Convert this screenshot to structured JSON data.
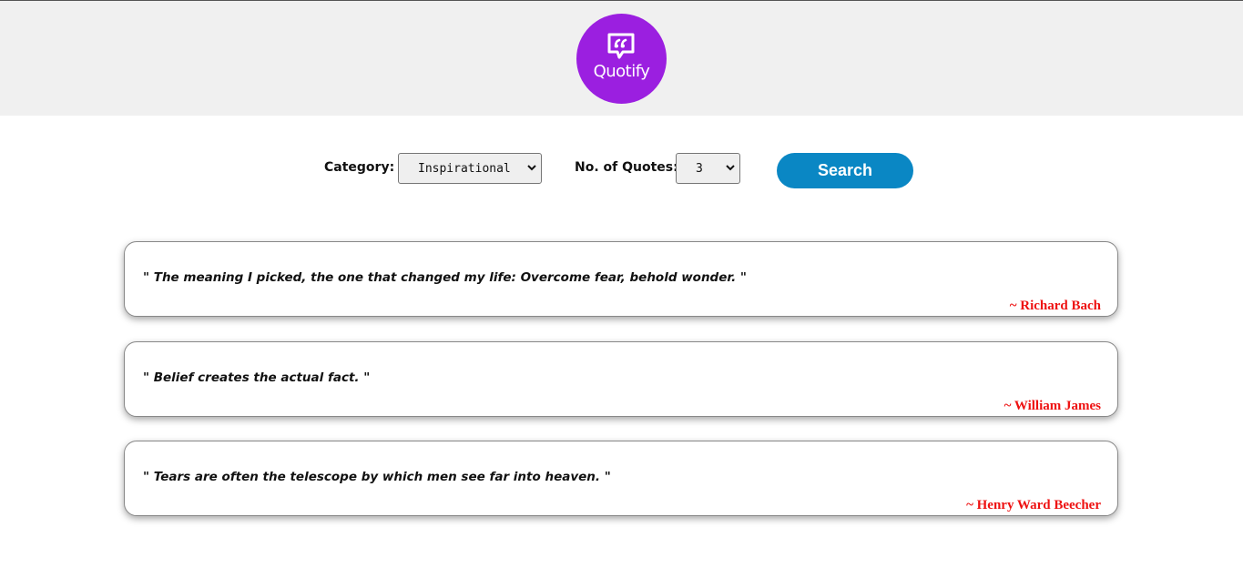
{
  "header": {
    "logo_text": "Quotify",
    "logo_color": "#9b1fe0"
  },
  "controls": {
    "category_label": "Category:",
    "category_value": "Inspirational",
    "count_label": "No. of Quotes:",
    "count_value": "3",
    "search_label": "Search",
    "button_color": "#0a87c4"
  },
  "quotes": [
    {
      "text": "\" The meaning I picked, the one that changed my life: Overcome fear, behold wonder. \"",
      "author": "~ Richard Bach"
    },
    {
      "text": "\" Belief creates the actual fact. \"",
      "author": "~ William James"
    },
    {
      "text": "\" Tears are often the telescope by which men see far into heaven. \"",
      "author": "~ Henry Ward Beecher"
    }
  ]
}
